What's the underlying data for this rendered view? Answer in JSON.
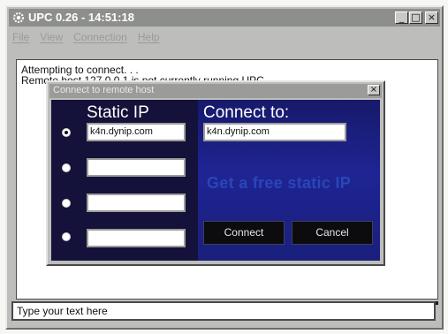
{
  "window": {
    "title": "UPC 0.26 - 14:51:18",
    "controls": {
      "minimize": "_",
      "maximize": "□",
      "close": "×"
    }
  },
  "menu": {
    "items": [
      {
        "label": "File"
      },
      {
        "label": "View"
      },
      {
        "label": "Connection"
      },
      {
        "label": "Help"
      }
    ]
  },
  "log": {
    "lines": [
      "Attempting to connect. . .",
      "Remote host 127.0.0.1 is not currently running UPC."
    ]
  },
  "message_input": {
    "value": "Type your text here"
  },
  "dialog": {
    "title": "Connect to remote host",
    "close": "×",
    "static_ip_header": "Static IP",
    "connect_to_header": "Connect to:",
    "static_ips": [
      "k4n.dynip.com",
      "",
      "",
      ""
    ],
    "selected_index": 0,
    "connect_to_value": "k4n.dynip.com",
    "ad_text": "Get a free static IP",
    "connect_button": "Connect",
    "cancel_button": "Cancel"
  },
  "colors": {
    "titlebar": "#8d8f8c",
    "dialog_panel": "#14123a",
    "blue_area": "#1e2493",
    "button": "#0c0c0f"
  }
}
